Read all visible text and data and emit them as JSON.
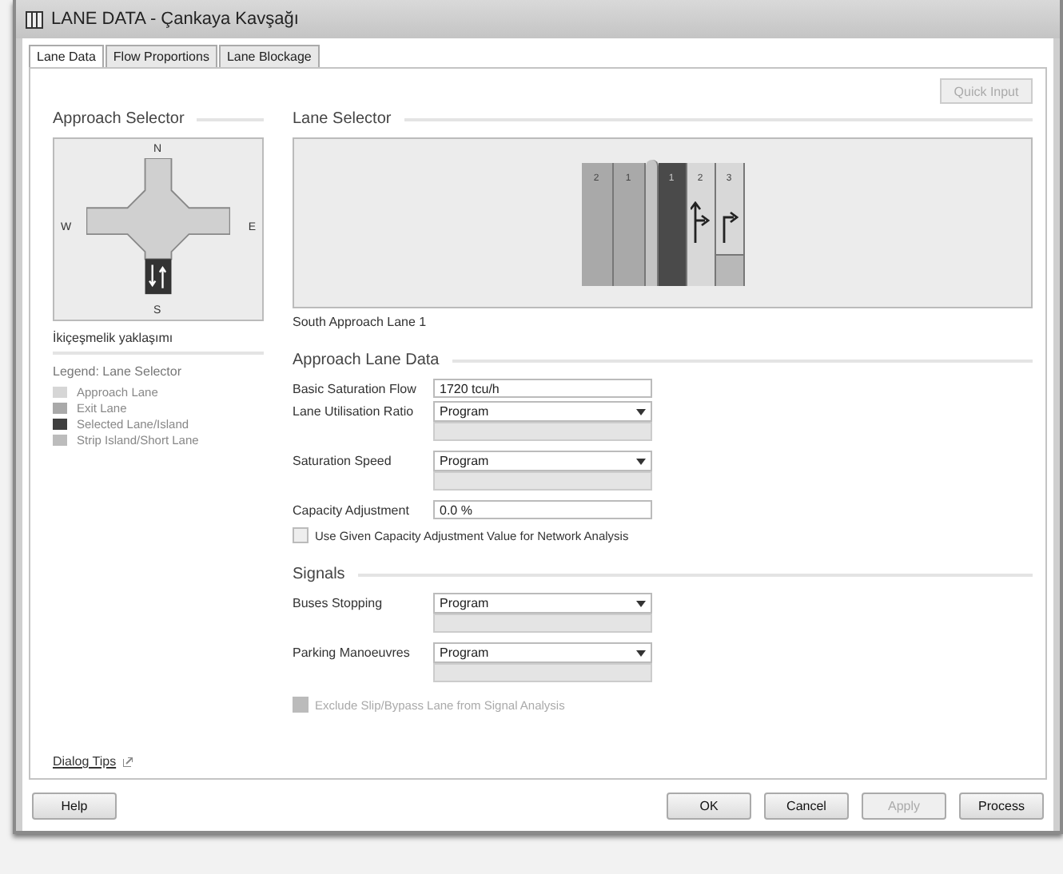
{
  "window": {
    "title": "LANE DATA - Çankaya Kavşağı"
  },
  "tabs": [
    {
      "label": "Lane Data",
      "selected": true
    },
    {
      "label": "Flow Proportions",
      "selected": false
    },
    {
      "label": "Lane Blockage",
      "selected": false
    }
  ],
  "quick_input": {
    "label": "Quick Input",
    "disabled": true
  },
  "approach_selector": {
    "title": "Approach Selector",
    "compass": {
      "n": "N",
      "w": "W",
      "e": "E",
      "s": "S"
    },
    "approach_name": "İkiçeşmelik yaklaşımı"
  },
  "legend": {
    "title": "Legend: Lane Selector",
    "items": [
      {
        "label": "Approach Lane",
        "color": "#d6d6d6"
      },
      {
        "label": "Exit Lane",
        "color": "#a9a9a9"
      },
      {
        "label": "Selected Lane/Island",
        "color": "#3f3f3f"
      },
      {
        "label": "Strip Island/Short Lane",
        "color": "#bcbcbc"
      }
    ]
  },
  "lane_selector": {
    "title": "Lane Selector",
    "caption": "South Approach Lane 1",
    "lanes": [
      {
        "number": "2",
        "kind": "exit",
        "selected": false
      },
      {
        "number": "1",
        "kind": "exit",
        "selected": false
      },
      {
        "kind": "island",
        "selected": false
      },
      {
        "number": "1",
        "kind": "approach",
        "selected": true
      },
      {
        "number": "2",
        "kind": "approach",
        "selected": false,
        "arrow": {
          "kind": "ahead-right"
        }
      },
      {
        "number": "3",
        "kind": "short",
        "selected": false,
        "arrow": {
          "kind": "right"
        }
      }
    ]
  },
  "approach_lane_data": {
    "title": "Approach Lane Data",
    "fields": [
      {
        "kind": "text",
        "label": "Basic Saturation Flow",
        "value": "1720 tcu/h"
      },
      {
        "kind": "dropdown",
        "label": "Lane Utilisation Ratio",
        "value": "Program"
      },
      {
        "kind": "dropdown",
        "label": "Saturation Speed",
        "value": "Program"
      },
      {
        "kind": "text",
        "label": "Capacity Adjustment",
        "value": "0.0 %"
      }
    ],
    "checkbox": {
      "label": "Use Given Capacity Adjustment Value for Network Analysis",
      "checked": false,
      "disabled": false
    }
  },
  "signals": {
    "title": "Signals",
    "fields": [
      {
        "kind": "dropdown",
        "label": "Buses Stopping",
        "value": "Program"
      },
      {
        "kind": "dropdown",
        "label": "Parking Manoeuvres",
        "value": "Program"
      }
    ],
    "checkbox": {
      "label": "Exclude Slip/Bypass Lane from Signal Analysis",
      "checked": false,
      "disabled": true
    }
  },
  "dialog_tips": "Dialog Tips",
  "buttons_left": [
    {
      "label": "Help",
      "disabled": false
    }
  ],
  "buttons_right": [
    {
      "label": "OK",
      "disabled": false
    },
    {
      "label": "Cancel",
      "disabled": false
    },
    {
      "label": "Apply",
      "disabled": true
    },
    {
      "label": "Process",
      "disabled": false
    }
  ]
}
